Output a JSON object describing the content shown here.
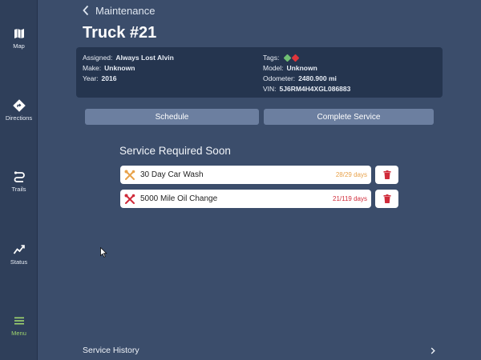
{
  "sidebar": {
    "items": [
      {
        "label": "Map",
        "icon": "map-icon"
      },
      {
        "label": "Directions",
        "icon": "directions-icon"
      },
      {
        "label": "Trails",
        "icon": "trails-icon"
      },
      {
        "label": "Status",
        "icon": "status-icon"
      },
      {
        "label": "Menu",
        "icon": "menu-icon",
        "active": true
      }
    ]
  },
  "header": {
    "back_label": "Maintenance",
    "title": "Truck #21"
  },
  "info": {
    "assigned_key": "Assigned:",
    "assigned_val": "Always Lost Alvin",
    "make_key": "Make:",
    "make_val": "Unknown",
    "year_key": "Year:",
    "year_val": "2016",
    "tags_key": "Tags:",
    "tags": [
      {
        "color": "#6fbf73"
      },
      {
        "color": "#e0353b"
      }
    ],
    "model_key": "Model:",
    "model_val": "Unknown",
    "odometer_key": "Odometer:",
    "odometer_val": "2480.900 mi",
    "vin_key": "VIN:",
    "vin_val": "5J6RM4H4XGL086883"
  },
  "actions": {
    "schedule_label": "Schedule",
    "complete_label": "Complete Service"
  },
  "service": {
    "section_title": "Service Required Soon",
    "items": [
      {
        "name": "30 Day Car Wash",
        "days": "28/29 days",
        "color": "#e8a24a"
      },
      {
        "name": "5000 Mile Oil Change",
        "days": "21/119 days",
        "color": "#d02b3a"
      }
    ]
  },
  "history": {
    "label": "Service History"
  },
  "colors": {
    "background": "#3b4d6b",
    "sidebar": "#2f3f5a",
    "accent_active": "#9fd56e",
    "button": "#6c7fa0",
    "danger": "#d02b3a"
  }
}
